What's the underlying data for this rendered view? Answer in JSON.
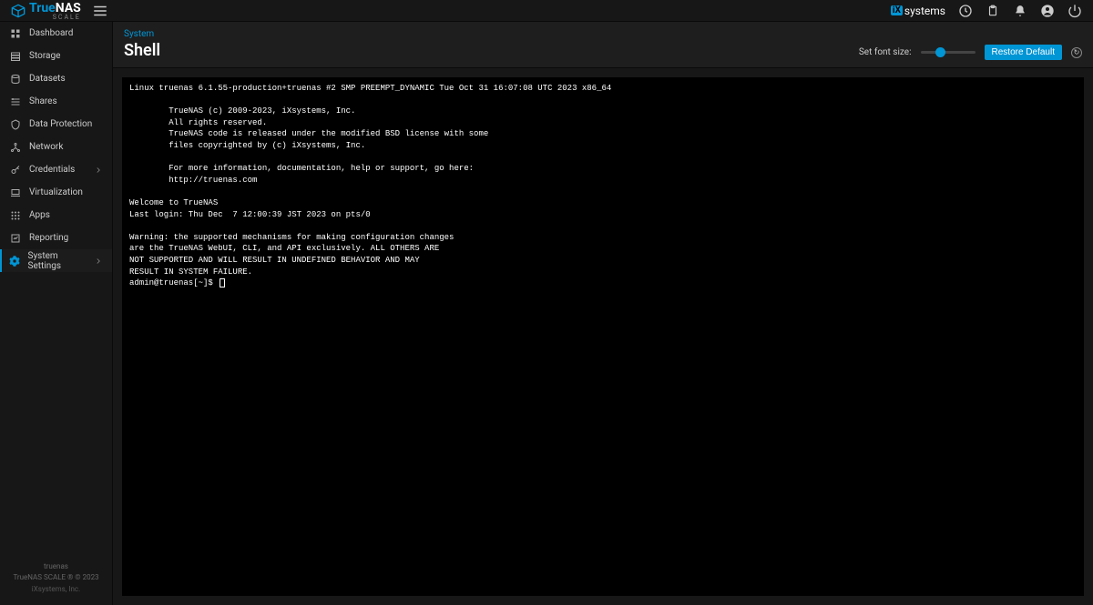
{
  "brand": {
    "true": "True",
    "nas": "NAS",
    "scale": "SCALE"
  },
  "ix": {
    "prefix": "iX",
    "suffix": "systems"
  },
  "sidebar": {
    "items": [
      {
        "label": "Dashboard"
      },
      {
        "label": "Storage"
      },
      {
        "label": "Datasets"
      },
      {
        "label": "Shares"
      },
      {
        "label": "Data Protection"
      },
      {
        "label": "Network"
      },
      {
        "label": "Credentials"
      },
      {
        "label": "Virtualization"
      },
      {
        "label": "Apps"
      },
      {
        "label": "Reporting"
      },
      {
        "label": "System Settings"
      }
    ],
    "footer": {
      "hostname": "truenas",
      "version": "TrueNAS SCALE ® © 2023",
      "company": "iXsystems, Inc."
    }
  },
  "page": {
    "breadcrumb": "System",
    "title": "Shell",
    "fontsize_label": "Set font size:",
    "restore_label": "Restore Default"
  },
  "terminal": {
    "lines": "Linux truenas 6.1.55-production+truenas #2 SMP PREEMPT_DYNAMIC Tue Oct 31 16:07:08 UTC 2023 x86_64\n\n        TrueNAS (c) 2009-2023, iXsystems, Inc.\n        All rights reserved.\n        TrueNAS code is released under the modified BSD license with some\n        files copyrighted by (c) iXsystems, Inc.\n\n        For more information, documentation, help or support, go here:\n        http://truenas.com\n\nWelcome to TrueNAS\nLast login: Thu Dec  7 12:00:39 JST 2023 on pts/0\n\nWarning: the supported mechanisms for making configuration changes\nare the TrueNAS WebUI, CLI, and API exclusively. ALL OTHERS ARE\nNOT SUPPORTED AND WILL RESULT IN UNDEFINED BEHAVIOR AND MAY\nRESULT IN SYSTEM FAILURE.\n",
    "prompt": "admin@truenas[~]$ "
  }
}
